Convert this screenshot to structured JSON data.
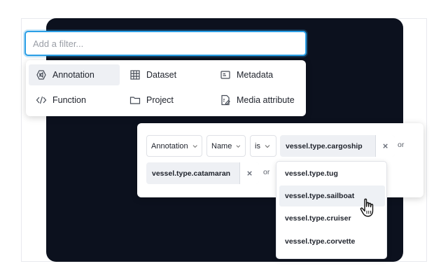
{
  "filter": {
    "placeholder": "Add a filter..."
  },
  "categories": [
    {
      "label": "Annotation",
      "icon": "annotation-icon",
      "active": true
    },
    {
      "label": "Dataset",
      "icon": "dataset-grid-icon"
    },
    {
      "label": "Metadata",
      "icon": "metadata-icon"
    },
    {
      "label": "Function",
      "icon": "code-icon"
    },
    {
      "label": "Project",
      "icon": "folder-icon"
    },
    {
      "label": "Media attribute",
      "icon": "media-attribute-icon"
    }
  ],
  "condition": {
    "field_type": "Annotation",
    "field": "Name",
    "operator": "is",
    "values": [
      "vessel.type.cargoship",
      "vessel.type.catamaran"
    ],
    "joiner": "or",
    "remove_symbol": "×"
  },
  "value_options": [
    {
      "label": "vessel.type.tug"
    },
    {
      "label": "vessel.type.sailboat",
      "hovered": true
    },
    {
      "label": "vessel.type.cruiser"
    },
    {
      "label": "vessel.type.corvette"
    }
  ],
  "colors": {
    "focus": "#2b9fe6",
    "dark_background": "#0c111e",
    "hover": "#eef1f5"
  },
  "cursor": "hand-pointer-icon"
}
